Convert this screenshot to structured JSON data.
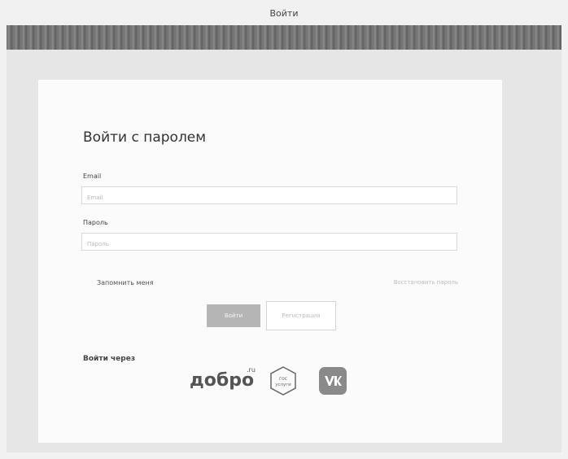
{
  "page": {
    "caption": "Войти"
  },
  "form": {
    "title": "Войти с паролем",
    "email_label": "Email",
    "email_placeholder": "Email",
    "password_label": "Пароль",
    "password_placeholder": "Пароль",
    "remember_label": "Запомнить меня",
    "forgot_label": "Восстановить пароль",
    "login_button": "Войти",
    "register_button": "Регистрация"
  },
  "social": {
    "title": "Войти через",
    "dobro_text": "добро",
    "dobro_ru": ".ru",
    "gos_line1": "гос",
    "gos_line2": "услуги",
    "vk_icon": "vk-icon"
  },
  "colors": {
    "top_bar": "#777777",
    "card": "#fbfbfb",
    "button_primary": "#b5b5b5"
  }
}
